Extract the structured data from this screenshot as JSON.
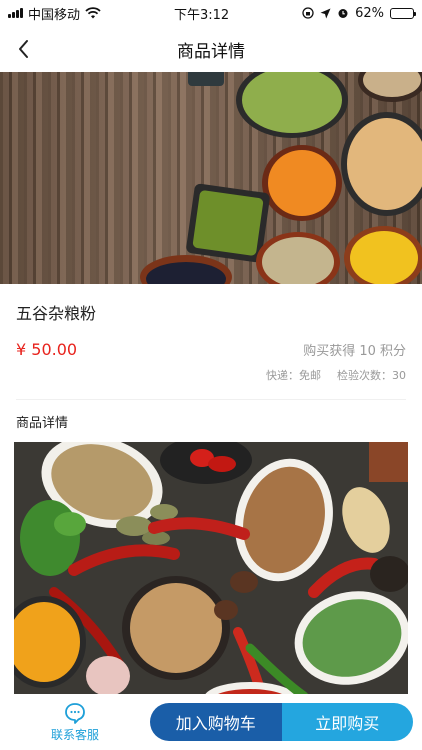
{
  "status_bar": {
    "carrier": "中国移动",
    "time": "下午3:12",
    "battery": "62%",
    "battery_level": 0.62
  },
  "nav": {
    "title": "商品详情",
    "back_icon": "chevron-left-icon"
  },
  "product": {
    "name": "五谷杂粮粉",
    "price": "¥ 50.00",
    "points": "购买获得 10 积分",
    "shipping": "快递：免邮",
    "inspections": "检验次数：30"
  },
  "detail": {
    "section_title": "商品详情"
  },
  "bottom_bar": {
    "service_label": "联系客服",
    "service_icon": "chat-bubble-icon",
    "add_to_cart": "加入购物车",
    "buy_now": "立即购买"
  },
  "colors": {
    "price": "#e8231d",
    "accent": "#1d9fd8",
    "cart_button": "#1a5ea8",
    "buy_button": "#24a6df"
  }
}
